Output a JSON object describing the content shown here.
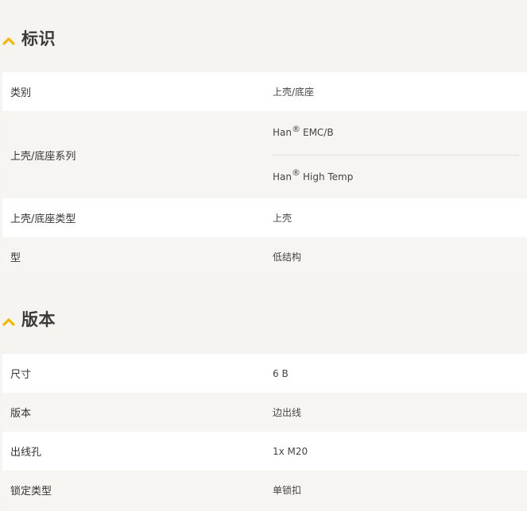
{
  "sections": [
    {
      "title": "标识",
      "rows": [
        {
          "key": "类别",
          "value": "上壳/底座"
        },
        {
          "key": "上壳/底座系列",
          "values": [
            {
              "prefix": "Han",
              "reg": "®",
              "suffix": "EMC/B"
            },
            {
              "prefix": "Han",
              "reg": "®",
              "suffix": "High Temp"
            }
          ]
        },
        {
          "key": "上壳/底座类型",
          "value": "上壳"
        },
        {
          "key": "型",
          "value": "低结构"
        }
      ]
    },
    {
      "title": "版本",
      "rows": [
        {
          "key": "尺寸",
          "value": "6 B"
        },
        {
          "key": "版本",
          "value": "边出线"
        },
        {
          "key": "出线孔",
          "value": "1x M20"
        },
        {
          "key": "锁定类型",
          "value": "单锁扣"
        }
      ]
    }
  ],
  "accent_color": "#f2b705",
  "icons": {
    "collapse": "chevron-up-icon"
  }
}
